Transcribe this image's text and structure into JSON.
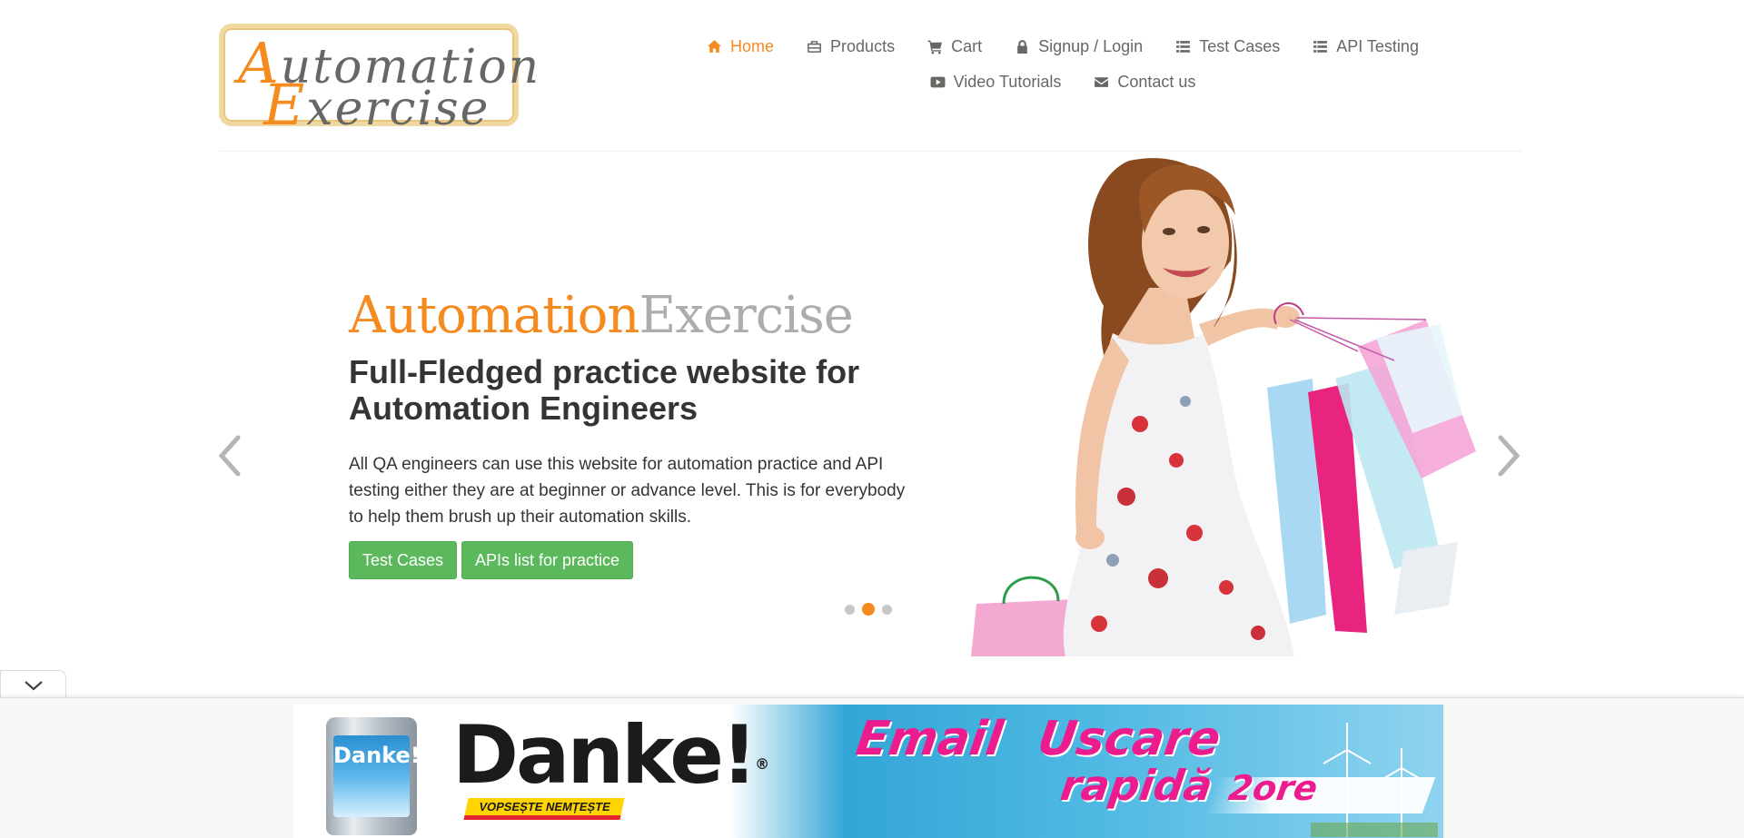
{
  "header": {
    "logo": {
      "line1_cap": "A",
      "line1_rest": "utomation",
      "line2_cap": "E",
      "line2_rest": "xercise"
    },
    "nav": [
      {
        "label": "Home",
        "icon": "home-icon",
        "active": true
      },
      {
        "label": "Products",
        "icon": "briefcase-icon"
      },
      {
        "label": "Cart",
        "icon": "cart-icon"
      },
      {
        "label": "Signup / Login",
        "icon": "lock-icon"
      },
      {
        "label": "Test Cases",
        "icon": "list-icon"
      },
      {
        "label": "API Testing",
        "icon": "list-icon"
      },
      {
        "label": "Video Tutorials",
        "icon": "youtube-icon"
      },
      {
        "label": "Contact us",
        "icon": "envelope-icon"
      }
    ]
  },
  "slider": {
    "brand_part1": "Automation",
    "brand_part2": "Exercise",
    "title": "Full-Fledged practice website for Automation Engineers",
    "description": "All QA engineers can use this website for automation practice and API testing either they are at beginner or advance level. This is for everybody to help them brush up their automation skills.",
    "buttons": {
      "test_cases": "Test Cases",
      "apis_list": "APIs list for practice"
    },
    "dots": {
      "count": 3,
      "active_index": 1
    }
  },
  "ad": {
    "can_label": "Danke!",
    "brand": "Danke!",
    "brand_mark": "®",
    "slogan": "VOPSEȘTE NEMȚEȘTE",
    "text_email": "Email",
    "text_uscare": "Uscare",
    "text_rapida": "rapidă",
    "text_2ore": "2ore"
  },
  "colors": {
    "accent": "#f58a1f",
    "button_green": "#5cb85c",
    "text_dark": "#363432",
    "text_gray": "#696763",
    "brand_gray": "#adadad"
  }
}
